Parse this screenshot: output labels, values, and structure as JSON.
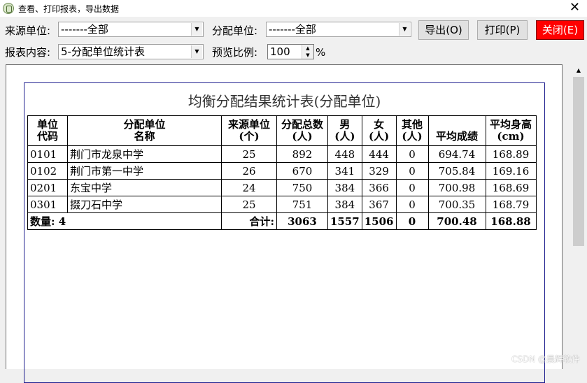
{
  "window": {
    "title": "查看、打印报表，导出数据",
    "close_glyph": "✕"
  },
  "toolbar": {
    "source_label": "来源单位:",
    "source_value": "-------全部",
    "dest_label": "分配单位:",
    "dest_value": "-------全部",
    "export_label": "导出(O)",
    "print_label": "打印(P)",
    "close_label": "关闭(E)",
    "report_label": "报表内容:",
    "report_value": "5-分配单位统计表",
    "zoom_label": "预览比例:",
    "zoom_value": "100",
    "zoom_unit": "%"
  },
  "report": {
    "title": "均衡分配结果统计表(分配单位)",
    "headers": [
      [
        "单位",
        "代码"
      ],
      [
        "分配单位",
        "名称"
      ],
      [
        "来源单位",
        "(个)"
      ],
      [
        "分配总数",
        "(人)"
      ],
      [
        "男",
        "(人)"
      ],
      [
        "女",
        "(人)"
      ],
      [
        "其他",
        "(人)"
      ],
      [
        "",
        "平均成绩"
      ],
      [
        "平均身高",
        "(cm)"
      ]
    ],
    "rows": [
      [
        "0101",
        "荆门市龙泉中学",
        "25",
        "892",
        "448",
        "444",
        "0",
        "694.74",
        "168.89"
      ],
      [
        "0102",
        "荆门市第一中学",
        "26",
        "670",
        "341",
        "329",
        "0",
        "705.84",
        "169.16"
      ],
      [
        "0201",
        "东宝中学",
        "24",
        "750",
        "384",
        "366",
        "0",
        "700.98",
        "168.69"
      ],
      [
        "0301",
        "掇刀石中学",
        "25",
        "751",
        "384",
        "367",
        "0",
        "700.35",
        "168.79"
      ]
    ],
    "total": {
      "count_label": "数量: 4",
      "sum_label": "合计:",
      "values": [
        "3063",
        "1557",
        "1506",
        "0",
        "700.48",
        "168.88"
      ]
    }
  },
  "watermark": "CSDN @晨辉软件",
  "colors": {
    "close_button": "#ff0000",
    "paper_border": "#1f1f8f"
  }
}
